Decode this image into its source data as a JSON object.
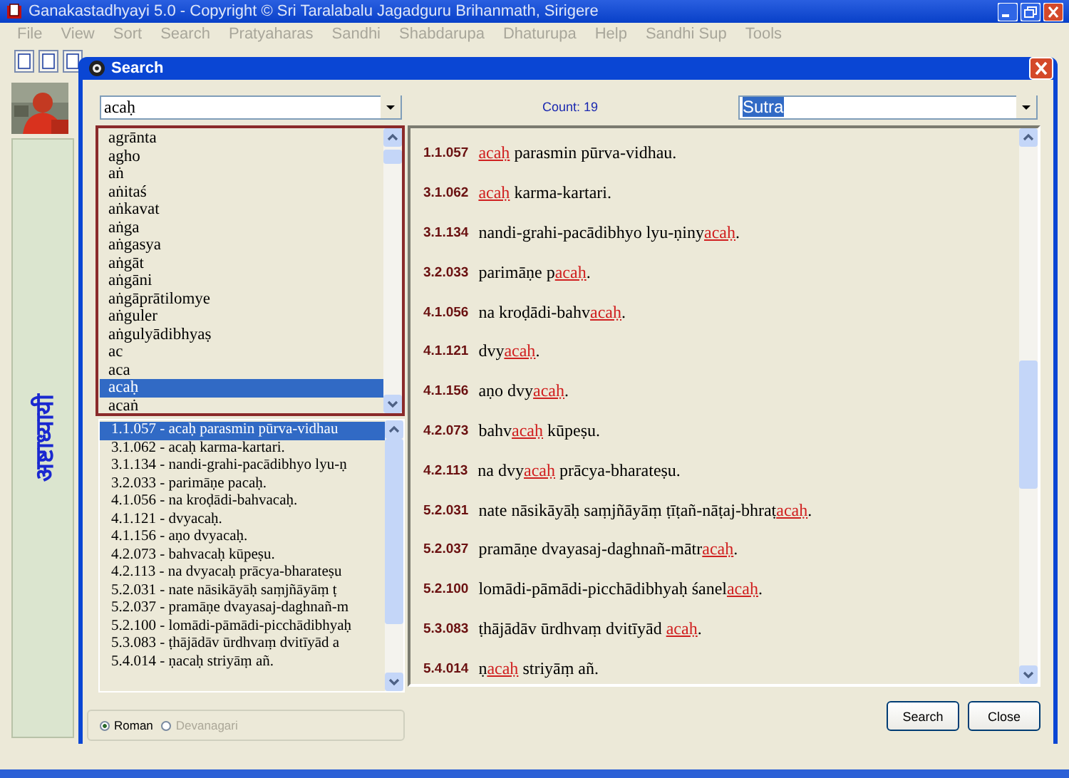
{
  "window": {
    "title": "Ganakastadhyayi 5.0 - Copyright © Sri Taralabalu Jagadguru Brihanmath, Sirigere"
  },
  "menu": [
    {
      "label": "File",
      "disabled": true
    },
    {
      "label": "View",
      "disabled": true
    },
    {
      "label": "Sort",
      "disabled": true
    },
    {
      "label": "Search",
      "disabled": true
    },
    {
      "label": "Pratyaharas",
      "disabled": true
    },
    {
      "label": "Sandhi",
      "disabled": true
    },
    {
      "label": "Shabdarupa",
      "disabled": true
    },
    {
      "label": "Dhaturupa",
      "disabled": true
    },
    {
      "label": "Help",
      "disabled": true
    },
    {
      "label": "Sandhi Sup",
      "disabled": true
    },
    {
      "label": "Tools",
      "disabled": true
    }
  ],
  "sidebar": {
    "vertical_title": "अष्टाध्यायी"
  },
  "dialog": {
    "title": "Search",
    "search_combo": {
      "value": "acaḥ"
    },
    "count": "Count: 19",
    "scope_combo": {
      "value": "Sutra"
    },
    "dropdown_items": [
      {
        "label": "agrānta",
        "selected": false
      },
      {
        "label": "agho",
        "selected": false
      },
      {
        "label": "aṅ",
        "selected": false
      },
      {
        "label": "aṅitaś",
        "selected": false
      },
      {
        "label": "aṅkavat",
        "selected": false
      },
      {
        "label": "aṅga",
        "selected": false
      },
      {
        "label": "aṅgasya",
        "selected": false
      },
      {
        "label": "aṅgāt",
        "selected": false
      },
      {
        "label": "aṅgāni",
        "selected": false
      },
      {
        "label": "aṅgāprātilomye",
        "selected": false
      },
      {
        "label": "aṅguler",
        "selected": false
      },
      {
        "label": "aṅgulyādibhyaṣ",
        "selected": false
      },
      {
        "label": "ac",
        "selected": false
      },
      {
        "label": "aca",
        "selected": false
      },
      {
        "label": "acaḥ",
        "selected": true
      },
      {
        "label": "acaṅ",
        "selected": false
      }
    ],
    "result_list": [
      {
        "label": "1.1.057 - acaḥ parasmin pūrva-vidhau",
        "selected": true
      },
      {
        "label": "3.1.062 - acaḥ karma-kartari.",
        "selected": false
      },
      {
        "label": "3.1.134 - nandi-grahi-pacādibhyo lyu-ṇ",
        "selected": false
      },
      {
        "label": "3.2.033 - parimāṇe pacaḥ.",
        "selected": false
      },
      {
        "label": "4.1.056 - na kroḍādi-bahvacaḥ.",
        "selected": false
      },
      {
        "label": "4.1.121 - dvyacaḥ.",
        "selected": false
      },
      {
        "label": "4.1.156 - aṇo dvyacaḥ.",
        "selected": false
      },
      {
        "label": "4.2.073 - bahvacaḥ kūpeṣu.",
        "selected": false
      },
      {
        "label": "4.2.113 - na dvyacaḥ prācya-bharateṣu",
        "selected": false
      },
      {
        "label": "5.2.031 - nate nāsikāyāḥ saṃjñāyāṃ ṭ",
        "selected": false
      },
      {
        "label": "5.2.037 - pramāṇe dvayasaj-daghnañ-m",
        "selected": false
      },
      {
        "label": "5.2.100 - lomādi-pāmādi-picchādibhyaḥ",
        "selected": false
      },
      {
        "label": "5.3.083 - ṭhājādāv ūrdhvaṃ dvitīyād a",
        "selected": false
      },
      {
        "label": "5.4.014 - ṇacaḥ striyāṃ añ.",
        "selected": false
      }
    ],
    "sutras": [
      {
        "number": "1.1.057",
        "parts": [
          {
            "text": "acaḥ",
            "match": true
          },
          {
            "text": " parasmin pūrva-vidhau.",
            "match": false
          }
        ]
      },
      {
        "number": "3.1.062",
        "parts": [
          {
            "text": "acaḥ",
            "match": true
          },
          {
            "text": " karma-kartari.",
            "match": false
          }
        ]
      },
      {
        "number": "3.1.134",
        "parts": [
          {
            "text": "nandi-grahi-pacādibhyo lyu-ṇiny",
            "match": false
          },
          {
            "text": "acaḥ",
            "match": true
          },
          {
            "text": ".",
            "match": false
          }
        ]
      },
      {
        "number": "3.2.033",
        "parts": [
          {
            "text": "parimāṇe p",
            "match": false
          },
          {
            "text": "acaḥ",
            "match": true
          },
          {
            "text": ".",
            "match": false
          }
        ]
      },
      {
        "number": "4.1.056",
        "parts": [
          {
            "text": "na kroḍādi-bahv",
            "match": false
          },
          {
            "text": "acaḥ",
            "match": true
          },
          {
            "text": ".",
            "match": false
          }
        ]
      },
      {
        "number": "4.1.121",
        "parts": [
          {
            "text": "dvy",
            "match": false
          },
          {
            "text": "acaḥ",
            "match": true
          },
          {
            "text": ".",
            "match": false
          }
        ]
      },
      {
        "number": "4.1.156",
        "parts": [
          {
            "text": "aṇo dvy",
            "match": false
          },
          {
            "text": "acaḥ",
            "match": true
          },
          {
            "text": ".",
            "match": false
          }
        ]
      },
      {
        "number": "4.2.073",
        "parts": [
          {
            "text": "bahv",
            "match": false
          },
          {
            "text": "acaḥ",
            "match": true
          },
          {
            "text": " kūpeṣu.",
            "match": false
          }
        ]
      },
      {
        "number": "4.2.113",
        "parts": [
          {
            "text": "na dvy",
            "match": false
          },
          {
            "text": "acaḥ",
            "match": true
          },
          {
            "text": " prācya-bharateṣu.",
            "match": false
          }
        ]
      },
      {
        "number": "5.2.031",
        "parts": [
          {
            "text": "nate nāsikāyāḥ saṃjñāyāṃ ṭīṭañ-nāṭaj-bhraṭ",
            "match": false
          },
          {
            "text": "acaḥ",
            "match": true
          },
          {
            "text": ".",
            "match": false
          }
        ]
      },
      {
        "number": "5.2.037",
        "parts": [
          {
            "text": "pramāṇe dvayasaj-daghnañ-mātr",
            "match": false
          },
          {
            "text": "acaḥ",
            "match": true
          },
          {
            "text": ".",
            "match": false
          }
        ]
      },
      {
        "number": "5.2.100",
        "parts": [
          {
            "text": "lomādi-pāmādi-picchādibhyaḥ śanel",
            "match": false
          },
          {
            "text": "acaḥ",
            "match": true
          },
          {
            "text": ".",
            "match": false
          }
        ]
      },
      {
        "number": "5.3.083",
        "parts": [
          {
            "text": "ṭhājādāv ūrdhvaṃ dvitīyād ",
            "match": false
          },
          {
            "text": "acaḥ",
            "match": true
          },
          {
            "text": ".",
            "match": false
          }
        ]
      },
      {
        "number": "5.4.014",
        "parts": [
          {
            "text": "ṇ",
            "match": false
          },
          {
            "text": "acaḥ",
            "match": true
          },
          {
            "text": " striyāṃ añ.",
            "match": false
          }
        ]
      }
    ],
    "script_options": [
      {
        "label": "Roman",
        "selected": true,
        "disabled": false
      },
      {
        "label": "Devanagari",
        "selected": false,
        "disabled": true
      }
    ],
    "buttons": [
      "Search",
      "Close"
    ]
  }
}
